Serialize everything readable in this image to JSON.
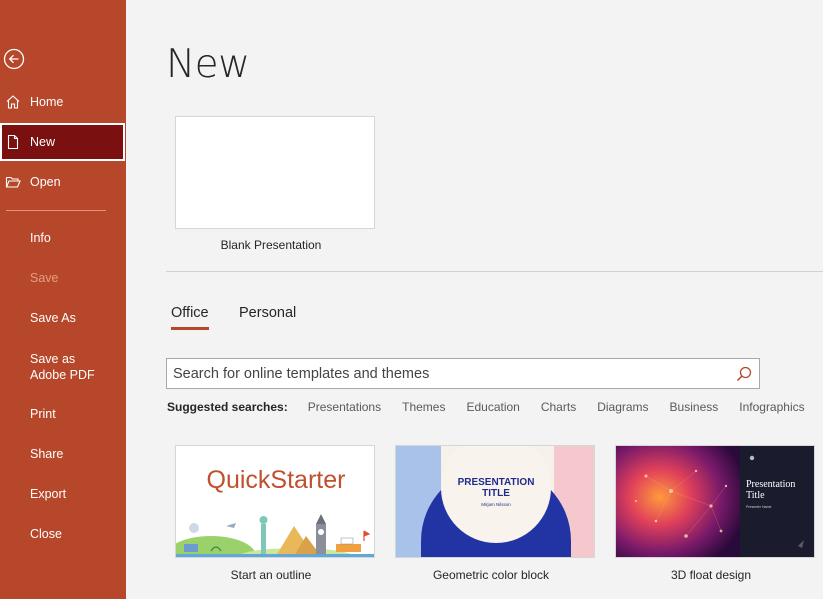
{
  "sidebar": {
    "items": [
      {
        "label": "Home"
      },
      {
        "label": "New"
      },
      {
        "label": "Open"
      },
      {
        "label": "Info"
      },
      {
        "label": "Save"
      },
      {
        "label": "Save As"
      },
      {
        "label": "Save as Adobe PDF"
      },
      {
        "label": "Print"
      },
      {
        "label": "Share"
      },
      {
        "label": "Export"
      },
      {
        "label": "Close"
      }
    ],
    "icons": [
      "back-arrow-icon",
      "home-icon",
      "new-document-icon",
      "open-folder-icon"
    ],
    "colors": {
      "background": "#b7472a",
      "active": "#7a1010",
      "disabled_text": "#e39d84"
    }
  },
  "main": {
    "title": "New",
    "blank": {
      "label": "Blank Presentation"
    },
    "tabs": [
      {
        "label": "Office",
        "active": true
      },
      {
        "label": "Personal",
        "active": false
      }
    ],
    "search": {
      "placeholder": "Search for online templates and themes"
    },
    "suggested": {
      "label": "Suggested searches:",
      "items": [
        "Presentations",
        "Themes",
        "Education",
        "Charts",
        "Diagrams",
        "Business",
        "Infographics"
      ]
    },
    "templates": [
      {
        "label": "Start an outline",
        "thumb_text": "QuickStarter"
      },
      {
        "label": "Geometric color block",
        "thumb_title": "PRESENTATION TITLE",
        "thumb_sub": "Mirjam Nilsson"
      },
      {
        "label": "3D float design",
        "thumb_title": "Presentation Title",
        "thumb_sub": "Presenter Name"
      }
    ],
    "colors": {
      "accent": "#b7472a"
    }
  }
}
